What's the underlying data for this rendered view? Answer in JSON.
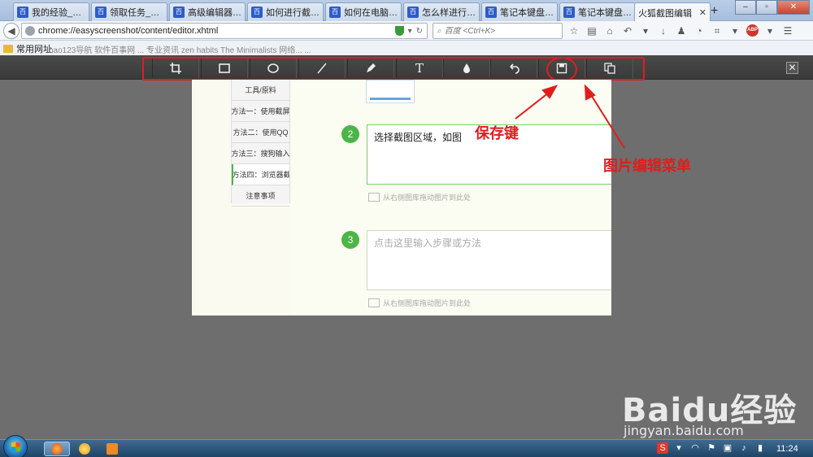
{
  "browser": {
    "tabs": [
      {
        "label": "我的经验_个人..."
      },
      {
        "label": "领取任务_百度..."
      },
      {
        "label": "高级编辑器_百..."
      },
      {
        "label": "如何进行截图_..."
      },
      {
        "label": "如何在电脑上..."
      },
      {
        "label": "怎么样进行截..."
      },
      {
        "label": "笔记本键盘_百..."
      },
      {
        "label": "笔记本键盘功..."
      },
      {
        "label": "火狐截图编辑",
        "active": true
      }
    ],
    "new_tab_label": "+",
    "url": "chrome://easyscreenshot/content/editor.xhtml",
    "search_placeholder": "百度 <Ctrl+K>",
    "abp_label": "ABP"
  },
  "bookmarks": {
    "first": "常用网址",
    "faded": "hao123导航   软件百事网   ...   专业资讯   zen habits   The Minimalists   网络...   ..."
  },
  "editor_toolbar": {
    "tools": [
      {
        "name": "crop",
        "icon": "crop-icon"
      },
      {
        "name": "rectangle",
        "icon": "rectangle-icon"
      },
      {
        "name": "ellipse",
        "icon": "ellipse-icon"
      },
      {
        "name": "line",
        "icon": "line-icon"
      },
      {
        "name": "pencil",
        "icon": "pencil-icon"
      },
      {
        "name": "text",
        "icon": "text-icon",
        "glyph": "T"
      },
      {
        "name": "blur",
        "icon": "blur-drop-icon"
      },
      {
        "name": "undo",
        "icon": "undo-icon"
      },
      {
        "name": "save",
        "icon": "save-icon"
      },
      {
        "name": "copy",
        "icon": "copy-icon"
      }
    ],
    "close_label": "✕"
  },
  "page": {
    "sidenav": [
      {
        "label": "工具/原料"
      },
      {
        "label": "方法一：使用截屏"
      },
      {
        "label": "方法二：使用QQ"
      },
      {
        "label": "方法三：搜狗输入"
      },
      {
        "label": "方法四：浏览器截",
        "active": true
      },
      {
        "label": "注意事项"
      }
    ],
    "steps": [
      {
        "number": "2",
        "text": "选择截图区域，如图",
        "hint": "从右侧图库拖动图片到此处"
      },
      {
        "number": "3",
        "text": "点击这里输入步骤或方法",
        "hint": "从右侧图库拖动图片到此处"
      }
    ]
  },
  "annotations": {
    "save_key": "保存键",
    "edit_menu": "图片编辑菜单",
    "color": "#e01d1d"
  },
  "watermark": {
    "main": "Baidu经验",
    "sub": "jingyan.baidu.com"
  },
  "taskbar": {
    "clock": "11:24"
  }
}
